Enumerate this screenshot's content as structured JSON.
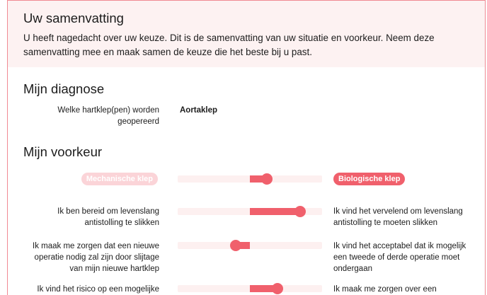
{
  "summary": {
    "title": "Uw samenvatting",
    "text": "U heeft nagedacht over uw keuze. Dit is de samenvatting van uw situatie en voorkeur. Neem deze samenvatting mee en maak samen de keuze die het beste bij u past."
  },
  "diagnosis": {
    "title": "Mijn diagnose",
    "question": "Welke hartklep(pen) worden geopereerd",
    "answer": "Aortaklep"
  },
  "preference": {
    "title": "Mijn voorkeur",
    "left_option": "Mechanische klep",
    "right_option": "Biologische klep",
    "overall_value": 0.62,
    "rows": [
      {
        "left": "Ik ben bereid om levenslang antistolling te slikken",
        "right": "Ik vind het vervelend om levenslang antistolling te moeten slikken",
        "value": 0.85
      },
      {
        "left": "Ik maak me zorgen dat een nieuwe operatie nodig zal zijn door slijtage van mijn nieuwe hartklep",
        "right": "Ik vind het acceptabel dat ik mogelijk een tweede of derde operatie moet ondergaan",
        "value": 0.4
      },
      {
        "left": "Ik vind het risico op een mogelijke",
        "right": "Ik maak me zorgen over een",
        "value": 0.69
      }
    ]
  },
  "colors": {
    "accent": "#f0606c",
    "accent_light": "#fbd4d8",
    "summary_bg": "#fdf2f2",
    "border": "#f08a93"
  }
}
